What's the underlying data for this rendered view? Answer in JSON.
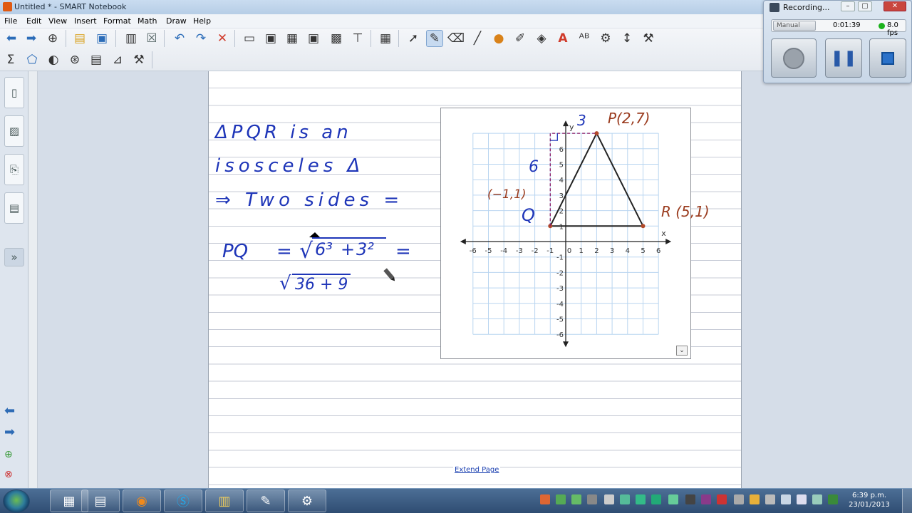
{
  "window": {
    "title": "Untitled * - SMART Notebook",
    "controls": [
      "–",
      "▢",
      "✕"
    ]
  },
  "menu": [
    "File",
    "Edit",
    "View",
    "Insert",
    "Format",
    "Math",
    "Draw",
    "Help"
  ],
  "page": {
    "extend_label": "Extend Page"
  },
  "handwriting": {
    "line1": "ΔPQR is an",
    "line2": "isosceles Δ",
    "line3": "⇒ Two sides =",
    "pq_label": "PQ",
    "equals1": "=",
    "radical1": "√",
    "term_a": "6³",
    "plus1": "+",
    "term_b": "3²",
    "equals2": "=",
    "radical2": "√",
    "sum_expr": "36 + 9",
    "ann_p": "P(2,7)",
    "ann_r": "R (5,1)",
    "ann_q_coord": "(−1,1)",
    "ann_q": "Q",
    "ann_6": "6",
    "ann_3": "3"
  },
  "chart_data": {
    "type": "scatter",
    "title": "",
    "xlabel": "x",
    "ylabel": "y",
    "xlim": [
      -6,
      6
    ],
    "ylim": [
      -6,
      7
    ],
    "grid": true,
    "x_ticks": [
      -6,
      -5,
      -4,
      -3,
      -2,
      -1,
      0,
      1,
      2,
      3,
      4,
      5,
      6
    ],
    "y_ticks": [
      -6,
      -5,
      -4,
      -3,
      -2,
      -1,
      1,
      2,
      3,
      4,
      5,
      6
    ],
    "series": [
      {
        "name": "",
        "type": "polygon",
        "points": [
          [
            -1,
            1
          ],
          [
            2,
            7
          ],
          [
            5,
            1
          ]
        ]
      },
      {
        "name": "",
        "type": "dashed",
        "points": [
          [
            -1,
            1
          ],
          [
            -1,
            7
          ],
          [
            2,
            7
          ]
        ]
      }
    ],
    "colors": {
      "grid": "#b9d5f0",
      "triangle": "#222222",
      "dashed": "#8a1a66",
      "point": "#b24a2a"
    }
  },
  "recorder": {
    "title": "Recording...",
    "mode": "Manual",
    "elapsed": "0:01:39",
    "fps": "8.0 fps",
    "buttons": [
      "record",
      "pause",
      "stop"
    ]
  },
  "taskbar": {
    "time": "6:39 p.m.",
    "date": "23/01/2013",
    "apps": [
      "calculator",
      "firefox",
      "skype",
      "explorer",
      "notebook",
      "recorder"
    ]
  }
}
